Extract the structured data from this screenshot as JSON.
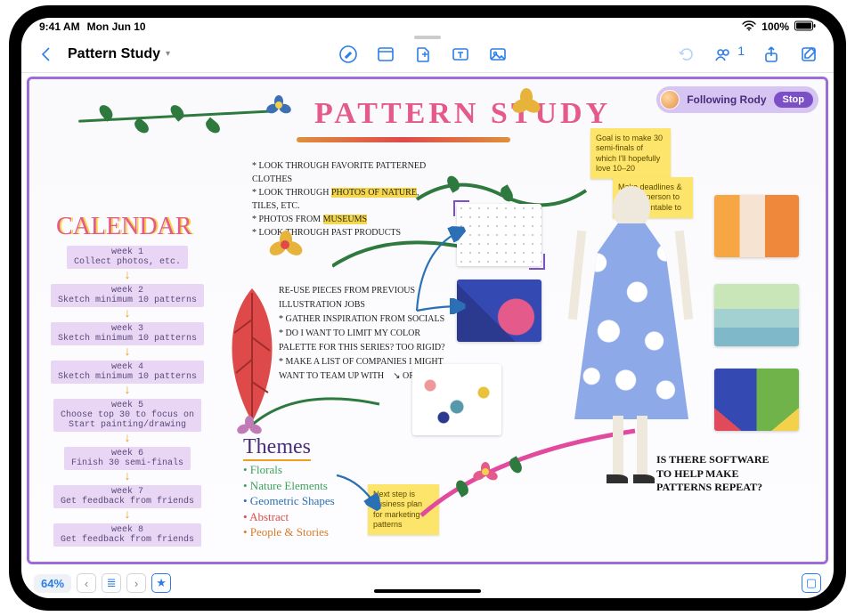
{
  "status": {
    "time": "9:41 AM",
    "date": "Mon Jun 10",
    "battery": "100%"
  },
  "toolbar": {
    "title": "Pattern Study",
    "collab_count": "1"
  },
  "following": {
    "label": "Following Rody",
    "stop": "Stop"
  },
  "board": {
    "title": "PATTERN STUDY",
    "calendar_heading": "CALENDAR",
    "themes_heading": "Themes",
    "themes": {
      "a": "• Florals",
      "b": "• Nature Elements",
      "c": "• Geometric Shapes",
      "d": "• Abstract",
      "e": "• People & Stories"
    },
    "bullets1": {
      "a": "* LOOK THROUGH FAVORITE PATTERNED CLOTHES",
      "b_pre": "* LOOK THROUGH ",
      "b_hl": "PHOTOS OF NATURE",
      "b_post": ", TILES, ETC.",
      "c_pre": "* PHOTOS FROM ",
      "c_hl": "MUSEUMS",
      "d": "* LOOK THROUGH PAST PRODUCTS"
    },
    "bullets2": {
      "a": "RE-USE PIECES FROM PREVIOUS ILLUSTRATION JOBS",
      "b": "* GATHER INSPIRATION FROM SOCIALS",
      "c": "* DO I WANT TO LIMIT MY COLOR PALETTE FOR THIS SERIES? TOO RIGID?",
      "d": "* MAKE A LIST OF COMPANIES I MIGHT WANT TO TEAM UP WITH",
      "d_tail": "OR BRANDS"
    },
    "question": "IS THERE SOFTWARE TO HELP MAKE PATTERNS REPEAT?",
    "sticky": {
      "s1": "Goal is to make 30 semi-finals of which I'll hopefully love 10–20",
      "s2": "Make deadlines & choose person to be accountable to",
      "s3": "Next step is business plan for marketing patterns"
    },
    "calendar": [
      {
        "wk": "week 1",
        "txt": "Collect photos, etc."
      },
      {
        "wk": "week 2",
        "txt": "Sketch minimum 10 patterns"
      },
      {
        "wk": "week 3",
        "txt": "Sketch minimum 10 patterns"
      },
      {
        "wk": "week 4",
        "txt": "Sketch minimum 10 patterns"
      },
      {
        "wk": "week 5",
        "txt": "Choose top 30 to focus on\nStart painting/drawing"
      },
      {
        "wk": "week 6",
        "txt": "Finish 30 semi-finals"
      },
      {
        "wk": "week 7",
        "txt": "Get feedback from friends"
      },
      {
        "wk": "week 8",
        "txt": "Get feedback from friends"
      }
    ]
  },
  "bottom": {
    "zoom": "64%"
  }
}
